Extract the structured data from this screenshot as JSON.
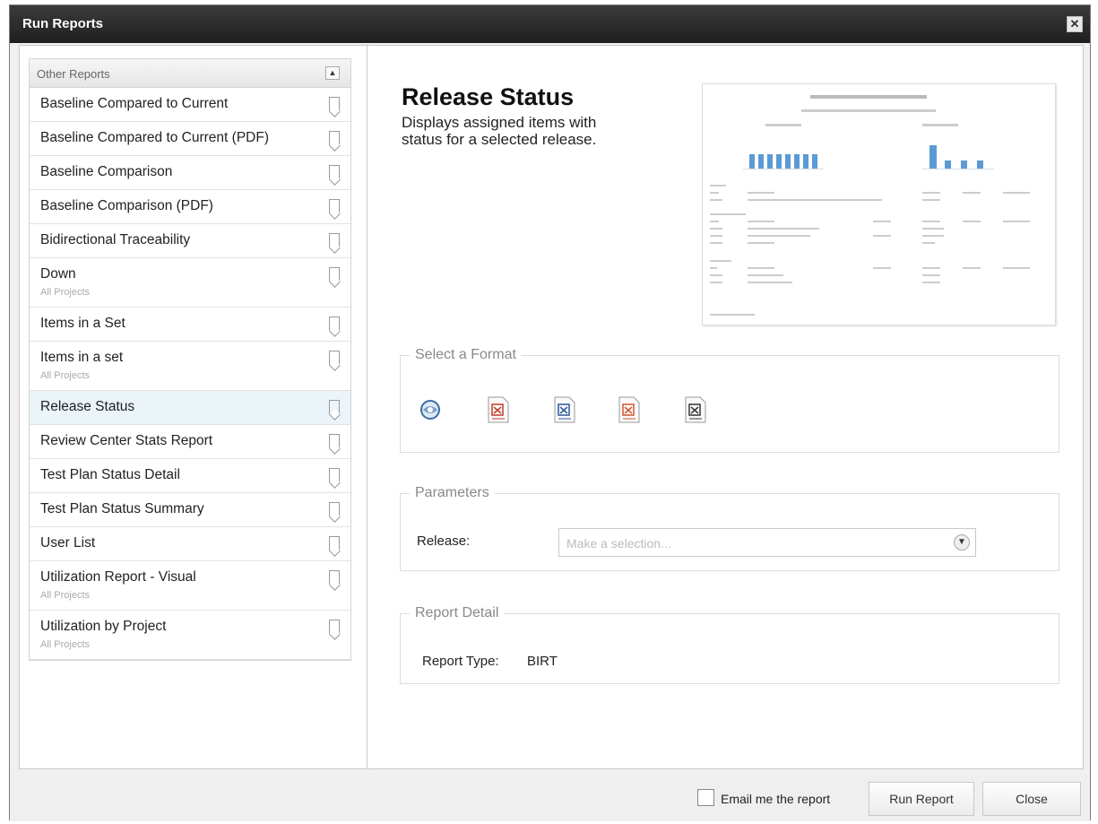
{
  "window": {
    "title": "Run Reports",
    "close_glyph": "✕"
  },
  "sidebar": {
    "header": "Other Reports",
    "collapse_glyph": "▲",
    "items": [
      {
        "label": "Baseline Compared to Current",
        "sub": ""
      },
      {
        "label": "Baseline Compared to Current (PDF)",
        "sub": ""
      },
      {
        "label": "Baseline Comparison",
        "sub": ""
      },
      {
        "label": "Baseline Comparison (PDF)",
        "sub": ""
      },
      {
        "label": "Bidirectional Traceability",
        "sub": ""
      },
      {
        "label": "Down",
        "sub": "All Projects"
      },
      {
        "label": "Items in a Set",
        "sub": ""
      },
      {
        "label": "Items in a set",
        "sub": "All Projects"
      },
      {
        "label": "Release Status",
        "sub": "",
        "selected": true
      },
      {
        "label": "Review Center Stats Report",
        "sub": ""
      },
      {
        "label": "Test Plan Status Detail",
        "sub": ""
      },
      {
        "label": "Test Plan Status Summary",
        "sub": ""
      },
      {
        "label": "User List",
        "sub": ""
      },
      {
        "label": "Utilization Report - Visual",
        "sub": "All Projects"
      },
      {
        "label": "Utilization by Project",
        "sub": "All Projects"
      }
    ]
  },
  "report": {
    "title": "Release Status",
    "description": "Displays assigned items with status for a selected release."
  },
  "format": {
    "legend": "Select a Format",
    "options": [
      {
        "name": "html-format-icon",
        "color": "#3a6ea5"
      },
      {
        "name": "pdf-format-icon",
        "color": "#c0392b"
      },
      {
        "name": "word-format-icon",
        "color": "#2b579a"
      },
      {
        "name": "powerpoint-format-icon",
        "color": "#d35230"
      },
      {
        "name": "excel-format-icon",
        "color": "#333333"
      }
    ]
  },
  "parameters": {
    "legend": "Parameters",
    "release_label": "Release:",
    "release_placeholder": "Make a selection...",
    "dropdown_glyph": "▼"
  },
  "detail": {
    "legend": "Report Detail",
    "type_label": "Report Type:",
    "type_value": "BIRT"
  },
  "footer": {
    "email_label": "Email me the report",
    "run_label": "Run Report",
    "close_label": "Close"
  },
  "colors": {
    "titlebar": "#2a2a2a",
    "selected_row": "#eaf4f9",
    "chart_bar": "#5b9bd5"
  }
}
